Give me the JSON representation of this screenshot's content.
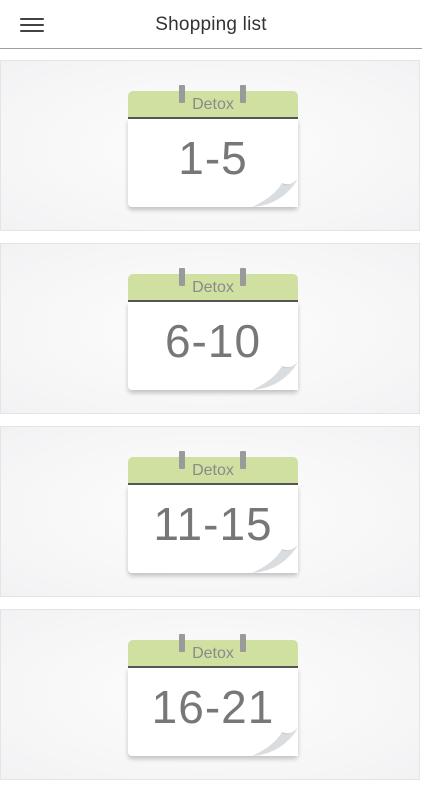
{
  "header": {
    "title": "Shopping list",
    "menu_icon": "hamburger-menu-icon"
  },
  "colors": {
    "calendar_header": "#cfe0a0",
    "number_text": "#777777",
    "label_text": "#8a8a8a"
  },
  "plans": [
    {
      "label": "Detox",
      "range": "1-5"
    },
    {
      "label": "Detox",
      "range": "6-10"
    },
    {
      "label": "Detox",
      "range": "11-15"
    },
    {
      "label": "Detox",
      "range": "16-21"
    }
  ]
}
